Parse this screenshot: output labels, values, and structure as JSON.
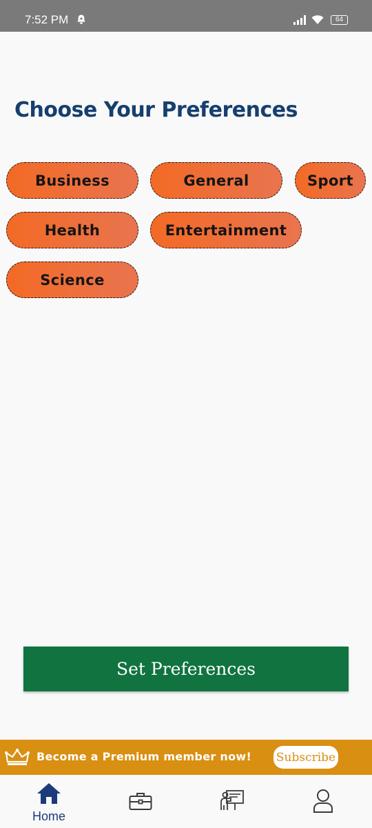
{
  "status_bar": {
    "time": "7:52 PM",
    "battery": "64"
  },
  "page": {
    "title": "Choose Your Preferences"
  },
  "preferences": [
    {
      "label": "Business"
    },
    {
      "label": "General"
    },
    {
      "label": "Sport"
    },
    {
      "label": "Health"
    },
    {
      "label": "Entertainment"
    },
    {
      "label": "Science"
    }
  ],
  "actions": {
    "set_preferences": "Set Preferences"
  },
  "premium_banner": {
    "text": "Become a Premium member now!",
    "subscribe": "Subscribe"
  },
  "bottom_nav": {
    "items": [
      {
        "label": "Home",
        "icon": "home-icon",
        "active": true
      },
      {
        "label": "",
        "icon": "briefcase-icon",
        "active": false
      },
      {
        "label": "",
        "icon": "presentation-icon",
        "active": false
      },
      {
        "label": "",
        "icon": "profile-icon",
        "active": false
      }
    ]
  },
  "colors": {
    "title": "#173f6e",
    "chip_start": "#f36a25",
    "chip_end": "#e9744f",
    "button": "#107340",
    "banner": "#d98f12",
    "nav_active": "#1d3a7a"
  }
}
